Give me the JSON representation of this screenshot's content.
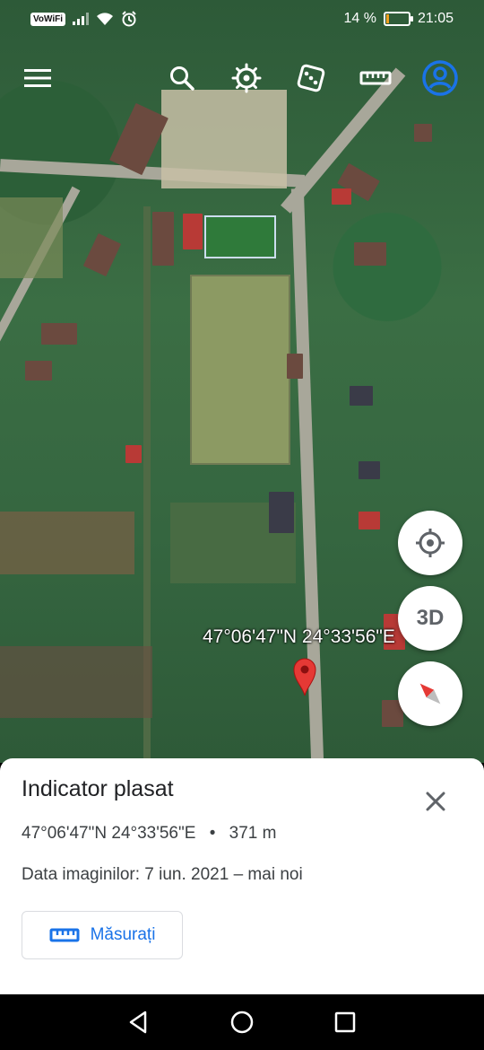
{
  "status_bar": {
    "vowifi": "VoWiFi",
    "battery_percent": "14 %",
    "battery_level": 0.14,
    "time": "21:05"
  },
  "toolbar": {
    "icons": [
      "menu-icon",
      "search-icon",
      "voyager-wheel-icon",
      "dice-icon",
      "ruler-icon",
      "account-icon"
    ]
  },
  "map": {
    "marker_label": "47°06'47\"N 24°33'56\"E"
  },
  "fabs": {
    "location": "my-location-icon",
    "three_d_label": "3D",
    "compass": "compass-icon"
  },
  "sheet": {
    "title": "Indicator plasat",
    "coords": "47°06'47\"N 24°33'56\"E",
    "separator": "•",
    "elevation": "371 m",
    "imagery_date": "Data imaginilor: 7 iun. 2021 – mai noi",
    "measure_label": "Măsurați"
  },
  "colors": {
    "accent": "#1a73e8",
    "pin": "#e53935",
    "account_ring": "#1a73e8"
  }
}
